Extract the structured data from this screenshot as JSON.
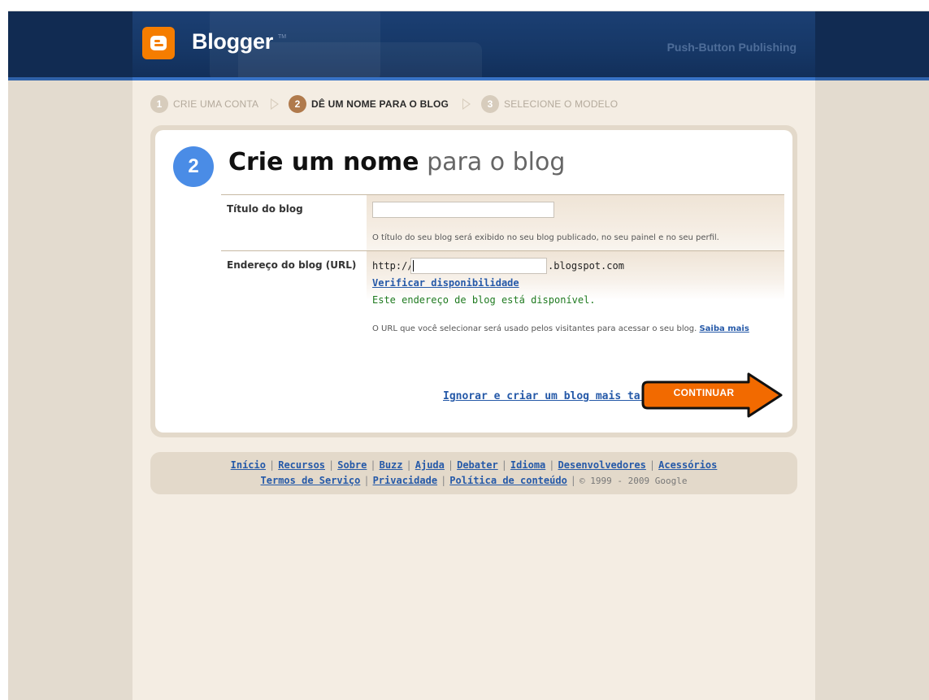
{
  "header": {
    "logo_text": "Blogger",
    "trademark": "TM",
    "tagline": "Push-Button Publishing"
  },
  "steps": [
    {
      "number": "1",
      "label": "CRIE UMA CONTA",
      "active": false
    },
    {
      "number": "2",
      "label": "DÊ UM NOME PARA O BLOG",
      "active": true
    },
    {
      "number": "3",
      "label": "SELECIONE O MODELO",
      "active": false
    }
  ],
  "card": {
    "step_number": "2",
    "title_bold": "Crie um nome",
    "title_rest": " para o blog",
    "blog_title": {
      "label": "Título do blog",
      "value": "",
      "hint": "O título do seu blog será exibido no seu blog publicado, no seu painel e no seu perfil."
    },
    "blog_url": {
      "label": "Endereço do blog (URL)",
      "prefix": "http://",
      "value": "",
      "suffix": ".blogspot.com",
      "verify_link": "Verificar disponibilidade",
      "availability": "Este endereço de blog está disponível.",
      "hint": "O URL que você selecionar será usado pelos visitantes para acessar o seu blog.",
      "learn_more": "Saiba mais"
    },
    "skip_link": "Ignorar e criar um blog mais tarde",
    "continue_button": "CONTINUAR"
  },
  "footer": {
    "links_row1": [
      "Início",
      "Recursos",
      "Sobre",
      "Buzz",
      "Ajuda",
      "Debater",
      "Idioma",
      "Desenvolvedores",
      "Acessórios"
    ],
    "links_row2": [
      "Termos de Serviço",
      "Privacidade",
      "Política de conteúdo"
    ],
    "copyright": "© 1999 - 2009 Google"
  },
  "colors": {
    "header_bg": "#14325c",
    "brand_orange": "#f57d00",
    "step_blue": "#4a8ce6",
    "link_blue": "#2559a8",
    "available_green": "#1f7a1f",
    "page_bg": "#f4ede3"
  }
}
